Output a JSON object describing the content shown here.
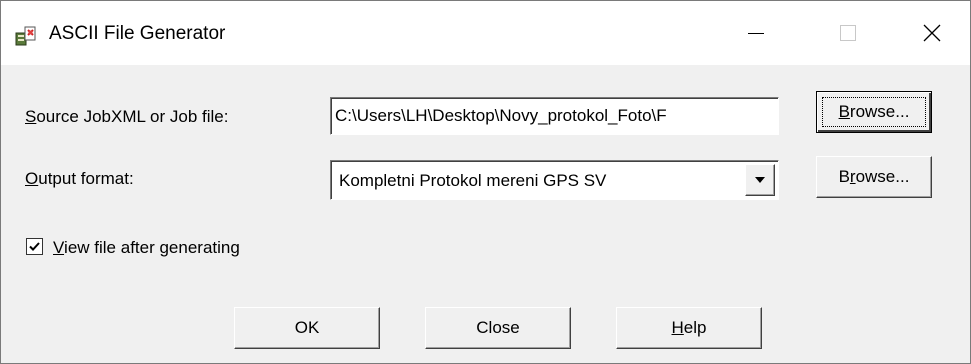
{
  "window": {
    "title": "ASCII File Generator",
    "controls": [
      "minimize-icon",
      "maximize-icon",
      "close-icon"
    ]
  },
  "source": {
    "label_prefix": "",
    "label_mnemonic": "S",
    "label_rest": "ource JobXML or Job file:",
    "value": "C:\\Users\\LH\\Desktop\\Novy_protokol_Foto\\F",
    "browse_pre": "",
    "browse_mn": "B",
    "browse_post": "rowse..."
  },
  "output": {
    "label_mnemonic": "O",
    "label_rest": "utput format:",
    "value": "Kompletni Protokol mereni GPS SV",
    "browse_pre": "B",
    "browse_mn": "r",
    "browse_post": "owse..."
  },
  "view_file": {
    "checked": true,
    "label_mnemonic": "V",
    "label_rest": "iew file after generating"
  },
  "buttons": {
    "ok": "OK",
    "close": "Close",
    "help_mn": "H",
    "help_rest": "elp"
  }
}
